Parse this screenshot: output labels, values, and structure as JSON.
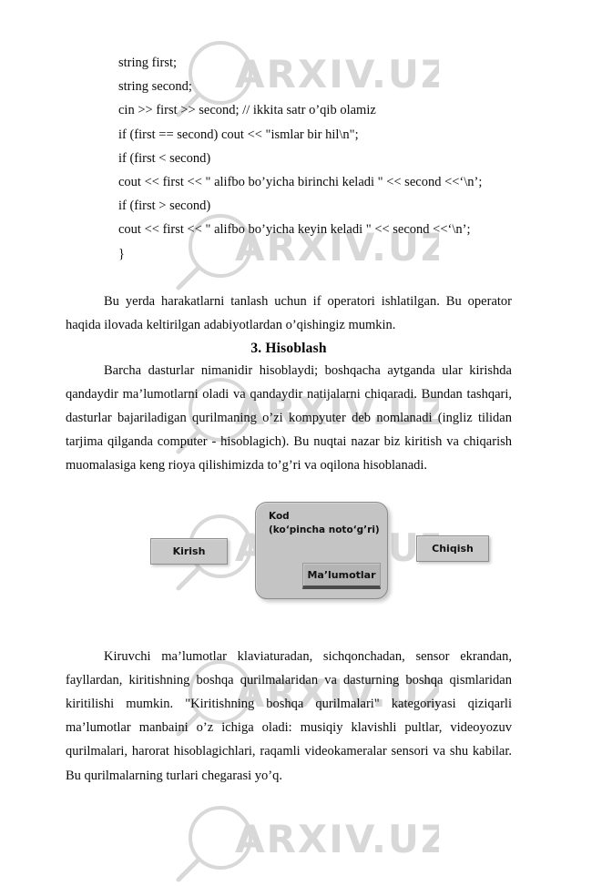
{
  "document": {
    "code_lines": [
      "string first;",
      "string second;",
      "cin >> first >> second; // ikkita satr o’qib olamiz",
      "if (first == second) cout << \"ismlar bir hil\\n\";",
      "if (first < second)",
      "cout << first << \" alifbo bo’yicha birinchi keladi \" << second <<‘\\n’;",
      "if (first > second)",
      "cout << first << \" alifbo bo’yicha keyin keladi \" << second <<‘\\n’;",
      "}"
    ],
    "paragraph_intro": "Bu yerda harakatlarni tanlash uchun if operatori ishlatilgan. Bu operator haqida ilovada keltirilgan adabiyotlardan o’qishingiz mumkin.",
    "section_heading": "3. Hisoblash",
    "paragraph_body": "Barcha dasturlar nimanidir hisoblaydi; boshqacha aytganda ular kirishda qandaydir ma’lumotlarni oladi va qandaydir natijalarni chiqaradi. Bundan tashqari, dasturlar bajariladigan qurilmaning o’zi kompyuter deb nomlanadi (ingliz tilidan tarjima qilganda computer - hisoblagich). Bu nuqtai nazar biz kiritish va chiqarish muomalasiga keng rioya qilishimizda to’g’ri va oqilona hisoblanadi.",
    "paragraph_tail": "Kiruvchi ma’lumotlar klaviaturadan, sichqonchadan, sensor ekrandan, fayllardan, kiritishning boshqa qurilmalaridan va dasturning boshqa qismlaridan kiritilishi mumkin. \"Kiritishning boshqa qurilmalari\" kategoriyasi qiziqarli ma’lumotlar manbaini o’z ichiga oladi: musiqiy klavishli pultlar, videoyozuv qurilmalari, harorat hisoblagichlari, raqamli videokameralar sensori va shu kabilar. Bu qurilmalarning turlari chegarasi yo’q."
  },
  "diagram": {
    "input_label": "Kirish",
    "code_label": "Kod\n(ko‘pincha noto‘g’ri)",
    "data_label": "Ma’lumotlar",
    "output_label": "Chiqish",
    "colors": {
      "node_fill": "#c9c9c9",
      "node_border": "#8d8d8d",
      "code_fill": "#c4c4c4",
      "data_fill": "#b4b4b4",
      "data_underline": "#4a4a4a"
    }
  },
  "watermark": {
    "text": "ARXIV.UZ",
    "color": "#d8d8d8",
    "icon": "magnifier-icon"
  }
}
